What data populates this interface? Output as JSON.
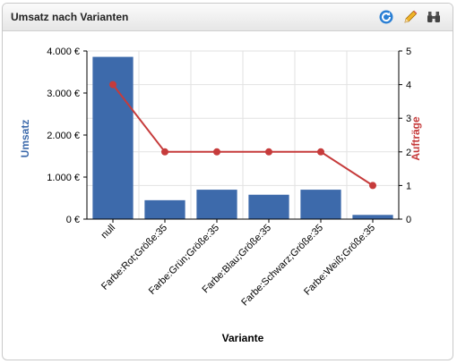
{
  "widget": {
    "title": "Umsatz nach Varianten",
    "tools": [
      {
        "name": "refresh-icon",
        "color": "#2a7fd4"
      },
      {
        "name": "pencil-icon",
        "color": "#e0a21b"
      },
      {
        "name": "binoculars-icon",
        "color": "#444444"
      }
    ]
  },
  "chart_data": {
    "type": "bar+line",
    "categories": [
      "null",
      "Farbe:Rot;Größe:35",
      "Farbe:Grün;Größe:35",
      "Farbe:Blau;Größe:35",
      "Farbe:Schwarz;Größe:35",
      "Farbe:Weiß;Größe:35"
    ],
    "series": [
      {
        "name": "Umsatz",
        "type": "bar",
        "axis": "left",
        "color": "#3d6aab",
        "values": [
          3860,
          450,
          700,
          580,
          700,
          100
        ]
      },
      {
        "name": "Aufträge",
        "type": "line",
        "axis": "right",
        "color": "#c63b3b",
        "values": [
          4,
          2,
          2,
          2,
          2,
          1
        ]
      }
    ],
    "xlabel": "Variante",
    "ylabel": "Umsatz",
    "y2label": "Aufträge",
    "ylim": [
      0,
      4000
    ],
    "y2lim": [
      0,
      5
    ],
    "yticks": [
      "0 €",
      "1.000 €",
      "2.000 €",
      "3.000 €",
      "4.000 €"
    ],
    "y2ticks": [
      "0",
      "1",
      "2",
      "3",
      "4",
      "5"
    ],
    "grid": true
  }
}
